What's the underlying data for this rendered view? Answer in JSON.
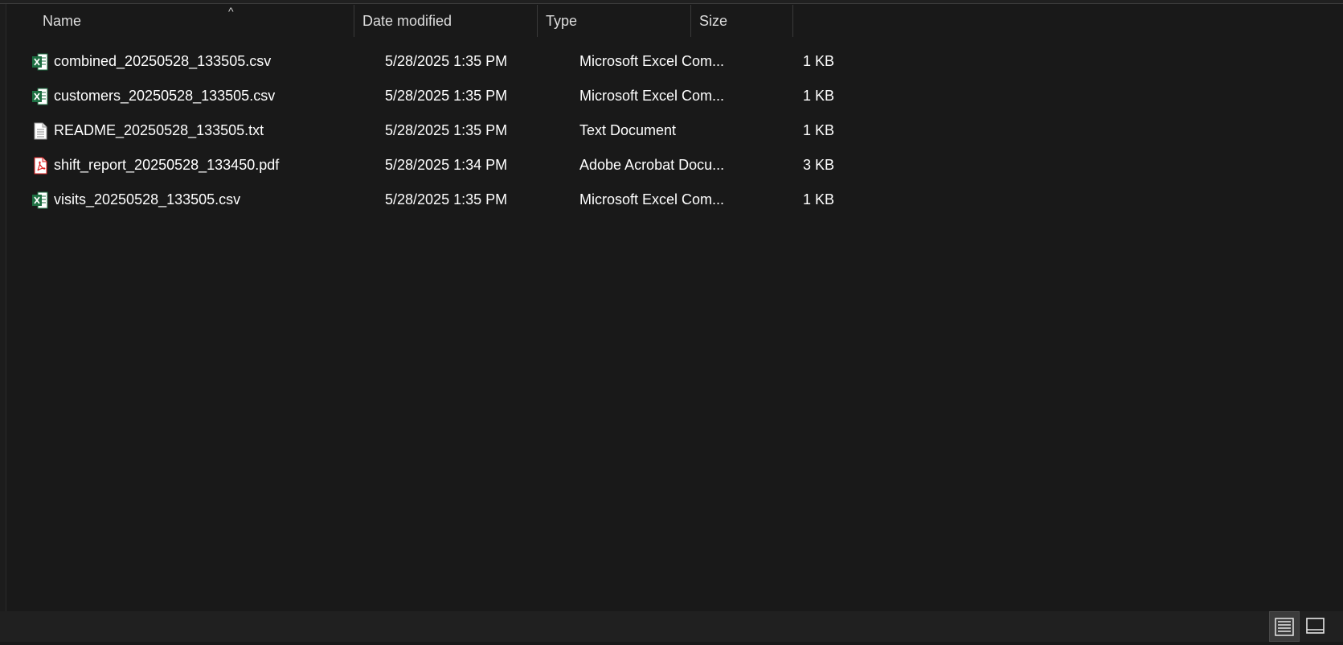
{
  "columns": {
    "name": "Name",
    "date": "Date modified",
    "type": "Type",
    "size": "Size"
  },
  "files": [
    {
      "name": "combined_20250528_133505.csv",
      "date": "5/28/2025 1:35 PM",
      "type": "Microsoft Excel Com...",
      "size": "1 KB",
      "icon": "excel-icon"
    },
    {
      "name": "customers_20250528_133505.csv",
      "date": "5/28/2025 1:35 PM",
      "type": "Microsoft Excel Com...",
      "size": "1 KB",
      "icon": "excel-icon"
    },
    {
      "name": "README_20250528_133505.txt",
      "date": "5/28/2025 1:35 PM",
      "type": "Text Document",
      "size": "1 KB",
      "icon": "text-document-icon"
    },
    {
      "name": "shift_report_20250528_133450.pdf",
      "date": "5/28/2025 1:34 PM",
      "type": "Adobe Acrobat Docu...",
      "size": "3 KB",
      "icon": "pdf-icon"
    },
    {
      "name": "visits_20250528_133505.csv",
      "date": "5/28/2025 1:35 PM",
      "type": "Microsoft Excel Com...",
      "size": "1 KB",
      "icon": "excel-icon"
    }
  ],
  "colors": {
    "background": "#191919",
    "excel": "#1d6f42",
    "pdf": "#e02020"
  }
}
